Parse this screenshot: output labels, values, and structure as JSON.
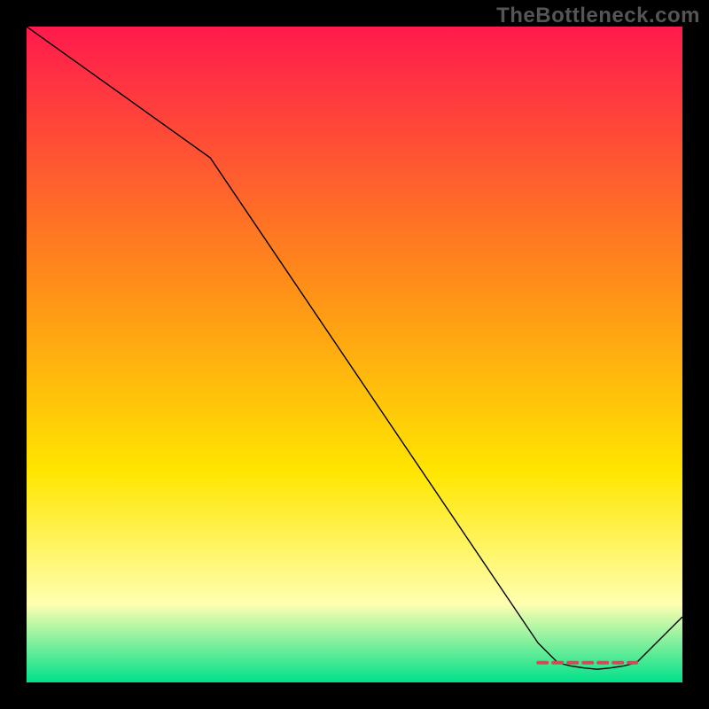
{
  "source_watermark": "TheBottleneck.com",
  "chart_data": {
    "type": "line",
    "title": "",
    "xlabel": "",
    "ylabel": "",
    "xlim": [
      0,
      100
    ],
    "ylim": [
      0,
      100
    ],
    "grid": false,
    "legend": false,
    "background_gradient": {
      "top": "#ff1a4d",
      "mid1": "#ff8a1a",
      "mid2": "#ffe600",
      "mid3": "#ffffb0",
      "bottom": "#00e08a"
    },
    "series": [
      {
        "name": "bottleneck-curve",
        "stroke": "#000000",
        "stroke_width": 1.4,
        "x": [
          0,
          28,
          78,
          81,
          83,
          85,
          87,
          89,
          91,
          93,
          100
        ],
        "y": [
          100,
          80,
          6,
          3,
          2.5,
          2.2,
          2.0,
          2.2,
          2.5,
          3,
          10
        ]
      }
    ],
    "markers": {
      "name": "optimal-range",
      "stroke": "#c94f57",
      "stroke_width": 4,
      "dasharray": "10,7",
      "x": [
        78,
        93
      ],
      "y": [
        3,
        3
      ]
    }
  }
}
